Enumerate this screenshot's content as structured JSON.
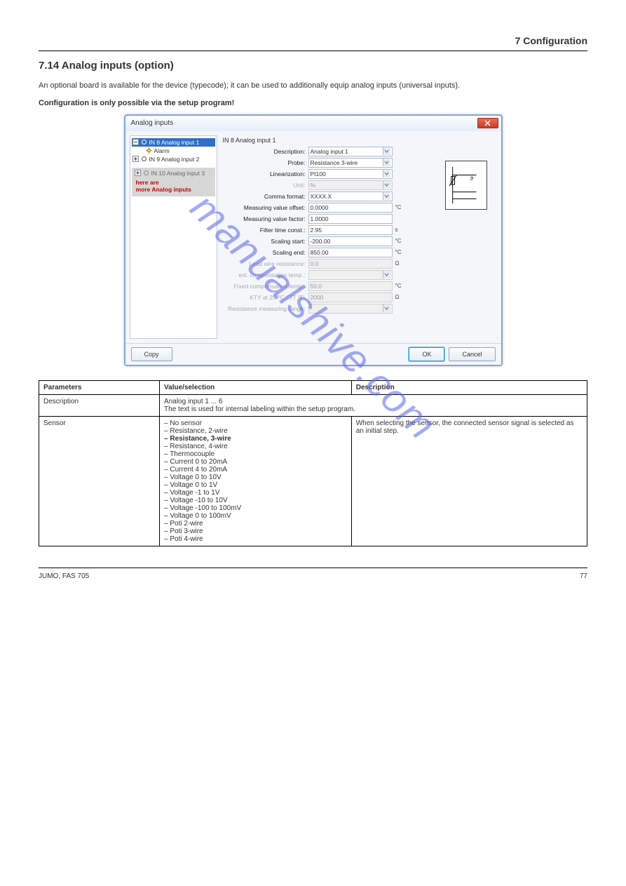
{
  "header": {
    "section_label": "7 Configuration"
  },
  "heading": "7.14 Analog inputs (option)",
  "intro": "An optional board is available for the device (typecode); it can be used to additionally equip analog inputs (universal inputs).",
  "config_note": "Configuration is only possible via the setup program!",
  "dialog": {
    "title": "Analog inputs",
    "tree": {
      "items": [
        {
          "label": "IN 8 Analog input 1",
          "selected": true
        },
        {
          "label": "Alarm",
          "child": true
        },
        {
          "label": "IN 9 Analog input 2"
        }
      ],
      "placeholder_row": "IN 10 Analog input 3",
      "annotation_line1": "here are",
      "annotation_line2": "more Analog inputs"
    },
    "form": {
      "panel_title": "IN 8 Analog input 1",
      "rows": [
        {
          "label": "Description:",
          "value": "Analog input 1",
          "type": "text-dd",
          "unit": ""
        },
        {
          "label": "Probe:",
          "value": "Resistance 3-wire",
          "type": "dd",
          "unit": ""
        },
        {
          "label": "Linearization:",
          "value": "Pt100",
          "type": "dd",
          "unit": ""
        },
        {
          "label": "Unit:",
          "value": "%",
          "type": "dd",
          "unit": "",
          "disabled": true
        },
        {
          "label": "Comma format:",
          "value": "XXXX.X",
          "type": "dd",
          "unit": ""
        },
        {
          "label": "Measuring value offset:",
          "value": "0.0000",
          "type": "text",
          "unit": "°C"
        },
        {
          "label": "Measuring value factor:",
          "value": "1.0000",
          "type": "text",
          "unit": ""
        },
        {
          "label": "Filter time const.:",
          "value": "2.95",
          "type": "text",
          "unit": "s"
        },
        {
          "label": "Scaling start:",
          "value": "-200.00",
          "type": "text",
          "unit": "°C"
        },
        {
          "label": "Scaling end:",
          "value": "850.00",
          "type": "text",
          "unit": "°C"
        },
        {
          "label": "Lead wire resistance:",
          "value": "0.0",
          "type": "text",
          "unit": "Ω",
          "disabled": true
        },
        {
          "label": "ext. compensation temp.:",
          "value": "",
          "type": "dd",
          "unit": "",
          "disabled": true
        },
        {
          "label": "Fixed compensation temp.:",
          "value": "50.0",
          "type": "text",
          "unit": "°C",
          "disabled": true
        },
        {
          "label": "KTY at 25 °C / 77 °F:",
          "value": "2000",
          "type": "text",
          "unit": "Ω",
          "disabled": true
        },
        {
          "label": "Resistance measuring range:",
          "value": "",
          "type": "dd",
          "unit": "",
          "disabled": true
        }
      ]
    },
    "buttons": {
      "copy": "Copy",
      "ok": "OK",
      "cancel": "Cancel"
    }
  },
  "table": {
    "headers": [
      "Parameters",
      "Value/selection",
      "Description"
    ],
    "rows": [
      {
        "param": "Description",
        "colspan_value": "Analog input 1 ... 6",
        "colspan_desc": "The text is used for internal labeling within the setup program."
      },
      {
        "param": "Sensor",
        "options": [
          "No sensor",
          "Resistance, 2-wire",
          "Resistance, 3-wire",
          "Resistance, 4-wire",
          "Thermocouple",
          "Current 0 to 20mA",
          "Current 4 to 20mA",
          "Voltage 0 to 10V",
          "Voltage 0 to 1V",
          "Voltage -1 to 1V",
          "Voltage -10 to 10V",
          "Voltage -100 to 100mV",
          "Voltage 0 to 100mV",
          "Poti 2-wire",
          "Poti 3-wire",
          "Poti 4-wire"
        ],
        "desc": "When selecting the sensor, the connected sensor signal is selected as an initial step."
      }
    ]
  },
  "footer": {
    "left": "JUMO, FAS 705",
    "right": "77"
  },
  "watermark": "manualshive.com"
}
